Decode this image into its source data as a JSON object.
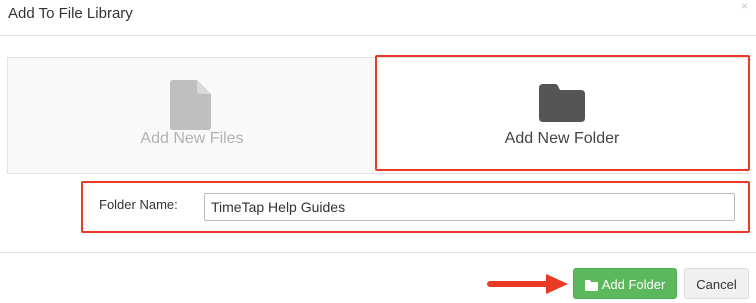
{
  "dialog": {
    "title": "Add To File Library",
    "close_glyph": "×"
  },
  "options": {
    "files_label": "Add New Files",
    "folder_label": "Add New Folder",
    "files_icon": "file-icon",
    "folder_icon": "folder-icon"
  },
  "form": {
    "folder_name_label": "Folder Name:",
    "folder_name_value": "TimeTap Help Guides"
  },
  "footer": {
    "add_folder_label": "Add Folder",
    "add_folder_icon": "folder-icon",
    "cancel_label": "Cancel"
  },
  "colors": {
    "highlight": "#ea3a25",
    "primary_green": "#5cb85c",
    "active_folder_icon": "#555555",
    "inactive_file_icon": "#bfbfbf"
  }
}
